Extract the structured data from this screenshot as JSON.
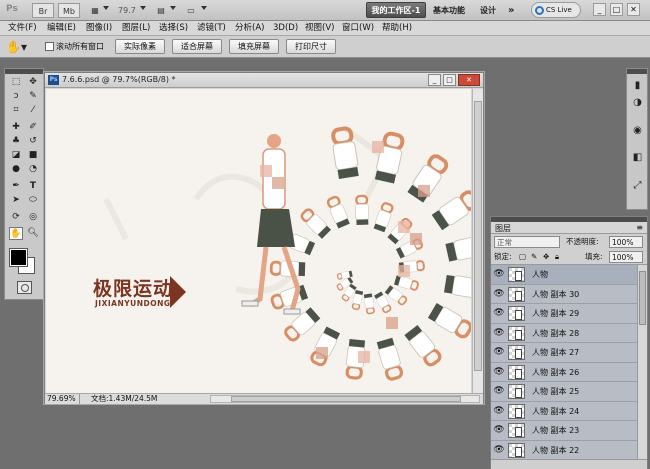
{
  "app_bar": {
    "ps_label": "Ps",
    "br_label": "Br",
    "mb_label": "Mb",
    "zoom_value": "79.7",
    "workspace_active": "我的工作区-1",
    "workspace_essentials": "基本功能",
    "workspace_design": "设计",
    "more_label": "»",
    "cslive": "CS Live"
  },
  "menu": [
    "文件(F)",
    "编辑(E)",
    "图像(I)",
    "图层(L)",
    "选择(S)",
    "滤镜(T)",
    "分析(A)",
    "3D(D)",
    "视图(V)",
    "窗口(W)",
    "帮助(H)"
  ],
  "options_bar": {
    "scroll_all": "滚动所有窗口",
    "actual_pixels": "实际像素",
    "fit_screen": "适合屏幕",
    "fill_screen": "填充屏幕",
    "print_size": "打印尺寸"
  },
  "document": {
    "title": "7.6.6.psd @ 79.7%(RGB/8) *",
    "status_zoom": "79.69%",
    "status_doc": "文档:1.43M/24.5M",
    "art_title": "极限运动",
    "art_subtitle": "JIXIANYUNDONG"
  },
  "layers_panel": {
    "tab_label": "图层",
    "blend_mode": "正常",
    "opacity_label": "不透明度:",
    "opacity_value": "100%",
    "lock_label": "锁定:",
    "fill_label": "填充:",
    "fill_value": "100%",
    "layers": [
      "人物",
      "人物 副本 30",
      "人物 副本 29",
      "人物 副本 28",
      "人物 副本 27",
      "人物 副本 26",
      "人物 副本 25",
      "人物 副本 24",
      "人物 副本 23",
      "人物 副本 22"
    ]
  },
  "colors": {
    "foreground": "#000000",
    "background": "#ffffff",
    "canvas": "#f6f3ee",
    "art_brand": "#7b3520"
  }
}
